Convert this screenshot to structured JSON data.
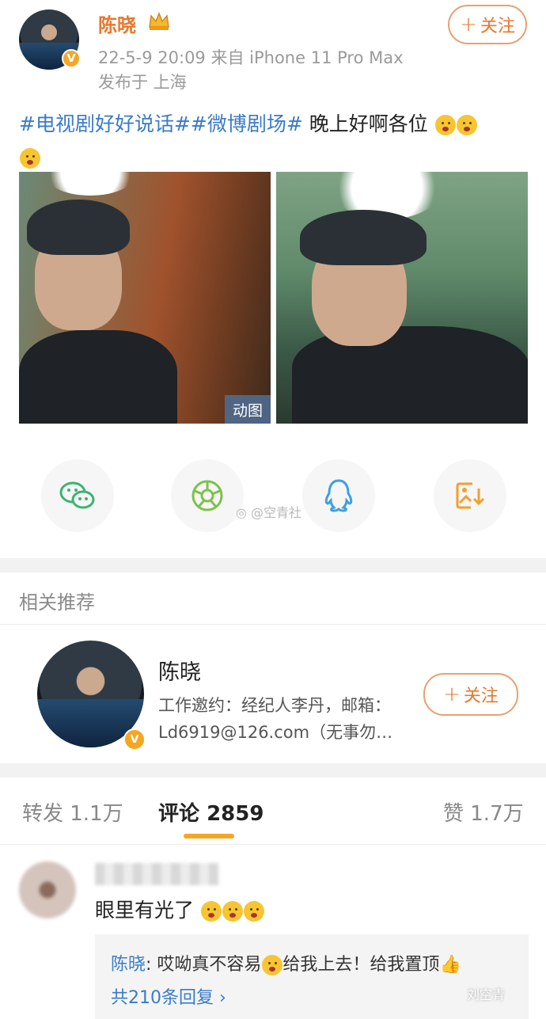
{
  "post": {
    "author": "陈晓",
    "meta": "22-5-9 20:09  来自 iPhone 11 Pro Max",
    "location": "发布于 上海",
    "follow_label": "关注",
    "hashtags": [
      "#电视剧好好说话#",
      "#微博剧场#"
    ],
    "text": " 晚上好啊各位",
    "gif_badge": "动图"
  },
  "share": {
    "icons": [
      "wechat-icon",
      "moments-icon",
      "qq-icon",
      "save-image-icon"
    ],
    "watermark": "@空青社"
  },
  "recommend": {
    "section_title": "相关推荐",
    "name": "陈晓",
    "desc_line1": "工作邀约：经纪人李丹，邮箱：",
    "desc_line2": "Ld6919@126.com（无事勿…",
    "follow_label": "关注"
  },
  "tabs": {
    "repost": "转发 1.1万",
    "comment_label": "评论",
    "comment_count": "2859",
    "like": "赞 1.7万"
  },
  "comment": {
    "text": "眼里有光了",
    "reply_author": "陈晓",
    "reply_text": ": 哎呦真不容易",
    "reply_text2": "给我上去！给我置顶",
    "reply_more": "共210条回复 ›"
  },
  "corner_watermark": "刘空青",
  "colors": {
    "accent": "#e8772e",
    "link": "#3a7bc8",
    "underline": "#f5a623"
  }
}
